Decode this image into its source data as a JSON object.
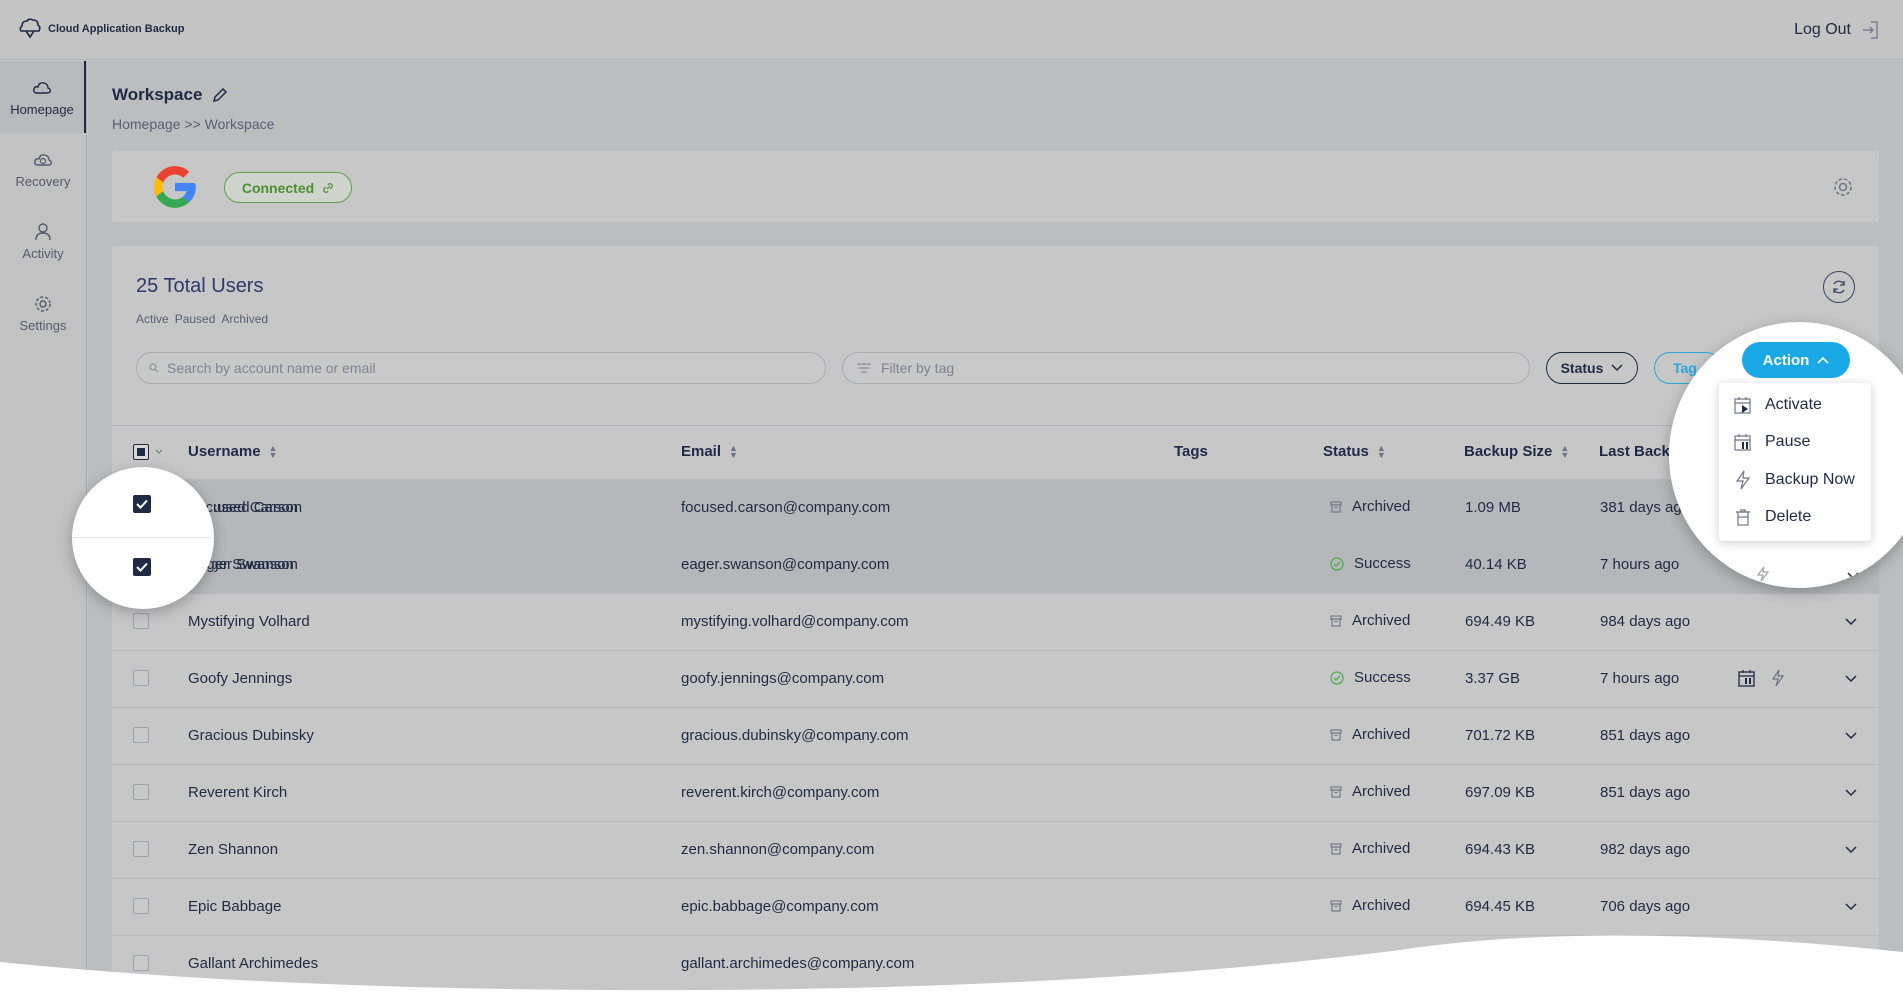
{
  "app": {
    "title": "Cloud Application Backup",
    "logout_label": "Log Out"
  },
  "sidebar": {
    "items": [
      {
        "label": "Homepage",
        "icon": "cloud-icon",
        "active": true
      },
      {
        "label": "Recovery",
        "icon": "cloud-recovery-icon",
        "active": false
      },
      {
        "label": "Activity",
        "icon": "user-icon",
        "active": false
      },
      {
        "label": "Settings",
        "icon": "gear-icon",
        "active": false
      }
    ]
  },
  "page": {
    "title": "Workspace",
    "breadcrumb": "Homepage >> Workspace"
  },
  "connection": {
    "provider_icon": "google-logo",
    "status_label": "Connected"
  },
  "users": {
    "total_label": "25 Total Users",
    "filters": [
      "Active",
      "Paused",
      "Archived"
    ],
    "search_placeholder": "Search by account name or email",
    "tag_placeholder": "Filter by tag",
    "status_button": "Status",
    "tag_button": "Tag",
    "action_button": "Action"
  },
  "action_menu": {
    "items": [
      {
        "label": "Activate",
        "icon": "calendar-play-icon"
      },
      {
        "label": "Pause",
        "icon": "calendar-pause-icon"
      },
      {
        "label": "Backup Now",
        "icon": "lightning-icon"
      },
      {
        "label": "Delete",
        "icon": "trash-icon"
      }
    ]
  },
  "table": {
    "columns": [
      "Username",
      "Email",
      "Tags",
      "Status",
      "Backup Size",
      "Last Backup"
    ],
    "rows": [
      {
        "username": "Focused Carson",
        "email": "focused.carson@company.com",
        "status": "Archived",
        "size": "1.09 MB",
        "last": "381 days ago",
        "selected": true
      },
      {
        "username": "Eager Swanson",
        "email": "eager.swanson@company.com",
        "status": "Success",
        "size": "40.14 KB",
        "last": "7 hours ago",
        "selected": true
      },
      {
        "username": "Mystifying Volhard",
        "email": "mystifying.volhard@company.com",
        "status": "Archived",
        "size": "694.49 KB",
        "last": "984 days ago",
        "selected": false
      },
      {
        "username": "Goofy Jennings",
        "email": "goofy.jennings@company.com",
        "status": "Success",
        "size": "3.37 GB",
        "last": "7 hours ago",
        "selected": false
      },
      {
        "username": "Gracious Dubinsky",
        "email": "gracious.dubinsky@company.com",
        "status": "Archived",
        "size": "701.72 KB",
        "last": "851 days ago",
        "selected": false
      },
      {
        "username": "Reverent Kirch",
        "email": "reverent.kirch@company.com",
        "status": "Archived",
        "size": "697.09 KB",
        "last": "851 days ago",
        "selected": false
      },
      {
        "username": "Zen Shannon",
        "email": "zen.shannon@company.com",
        "status": "Archived",
        "size": "694.43 KB",
        "last": "982 days ago",
        "selected": false
      },
      {
        "username": "Epic Babbage",
        "email": "epic.babbage@company.com",
        "status": "Archived",
        "size": "694.45 KB",
        "last": "706 days ago",
        "selected": false
      },
      {
        "username": "Gallant Archimedes",
        "email": "gallant.archimedes@company.com",
        "status": "",
        "size": "",
        "last": "",
        "selected": false
      }
    ]
  },
  "colors": {
    "accent": "#1aa9e6",
    "navy": "#1f2a44",
    "success": "#4caf50",
    "connected": "#5fa04a"
  }
}
